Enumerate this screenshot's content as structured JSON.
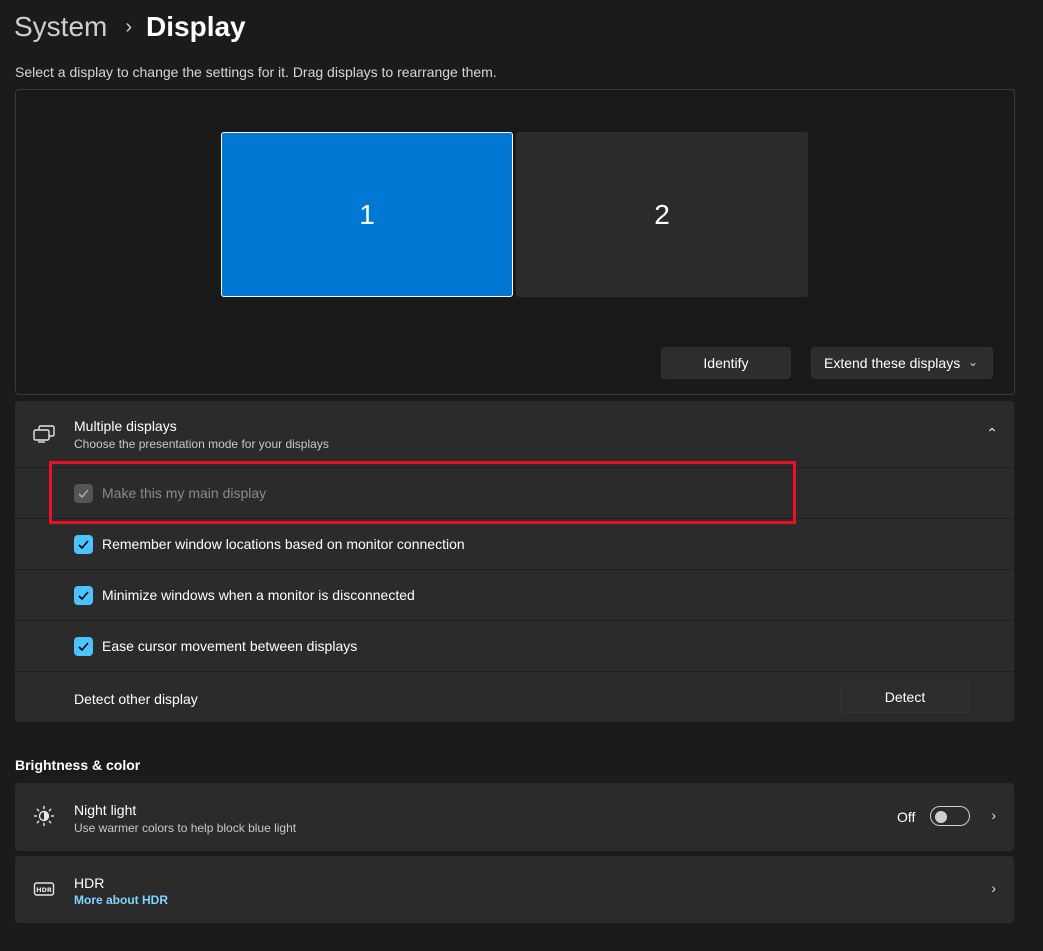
{
  "breadcrumb": {
    "parent": "System",
    "separator": "›",
    "current": "Display"
  },
  "subtitle": "Select a display to change the settings for it. Drag displays to rearrange them.",
  "arrangement": {
    "monitors": [
      {
        "label": "1",
        "selected": true
      },
      {
        "label": "2",
        "selected": false
      }
    ],
    "identify_label": "Identify",
    "extend_label": "Extend these displays"
  },
  "multiple_displays": {
    "title": "Multiple displays",
    "description": "Choose the presentation mode for your displays",
    "options": [
      {
        "label": "Make this my main display",
        "checked": true,
        "disabled": true
      },
      {
        "label": "Remember window locations based on monitor connection",
        "checked": true,
        "disabled": false
      },
      {
        "label": "Minimize windows when a monitor is disconnected",
        "checked": true,
        "disabled": false
      },
      {
        "label": "Ease cursor movement between displays",
        "checked": true,
        "disabled": false
      }
    ],
    "detect_label": "Detect other display",
    "detect_button": "Detect"
  },
  "brightness_section": {
    "heading": "Brightness & color",
    "night_light": {
      "title": "Night light",
      "description": "Use warmer colors to help block blue light",
      "state": "Off"
    },
    "hdr": {
      "title": "HDR",
      "link": "More about HDR"
    }
  },
  "colors": {
    "accent": "#0078d4",
    "checkbox": "#4cc2ff",
    "link": "#80d4ff",
    "highlight": "#e81123"
  }
}
